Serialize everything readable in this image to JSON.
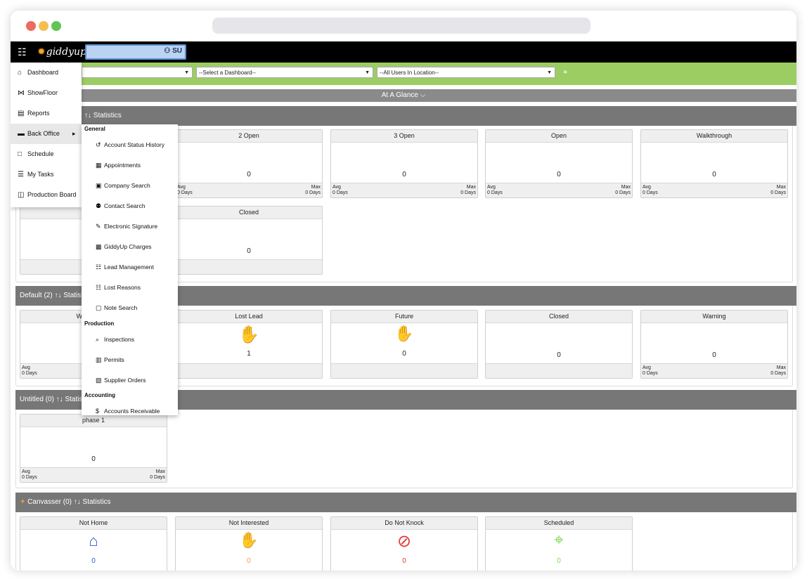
{
  "app": {
    "name": "giddyup",
    "user_badge": "SU"
  },
  "filters": {
    "select1": "",
    "select2": "--Select a Dashboard--",
    "select3": "--All Users In Location--"
  },
  "glance": "At A Glance ⌵",
  "nav": {
    "items": [
      {
        "label": "Dashboard",
        "icon": "⌂"
      },
      {
        "label": "ShowFloor",
        "icon": "⋈"
      },
      {
        "label": "Reports",
        "icon": "▤"
      },
      {
        "label": "Back Office",
        "icon": "▬",
        "caret": "▸"
      },
      {
        "label": "Schedule",
        "icon": "□"
      },
      {
        "label": "My Tasks",
        "icon": "☰"
      },
      {
        "label": "Production Board",
        "icon": "◫"
      }
    ]
  },
  "submenu": {
    "general": "General",
    "general_items": [
      {
        "label": "Account Status History",
        "icon": "↺"
      },
      {
        "label": "Appointments",
        "icon": "▦"
      },
      {
        "label": "Company Search",
        "icon": "▣"
      },
      {
        "label": "Contact Search",
        "icon": "⚉"
      },
      {
        "label": "Electronic Signature",
        "icon": "✎"
      },
      {
        "label": "GiddyUp Charges",
        "icon": "▩"
      },
      {
        "label": "Lead Management",
        "icon": "☷"
      },
      {
        "label": "Lost Reasons",
        "icon": "☷"
      },
      {
        "label": "Note Search",
        "icon": "▢"
      }
    ],
    "production": "Production",
    "production_items": [
      {
        "label": "Inspections",
        "icon": "⌕"
      },
      {
        "label": "Permits",
        "icon": "▥"
      },
      {
        "label": "Supplier Orders",
        "icon": "▧"
      }
    ],
    "accounting": "Accounting",
    "accounting_items": [
      {
        "label": "Accounts Receivable",
        "icon": "$"
      }
    ]
  },
  "sections": {
    "s1": {
      "title": "↑↓ Statistics",
      "cards": [
        {
          "title": "2 Open",
          "value": "0",
          "avg": "Avg",
          "avg_days": "0 Days",
          "max": "Max",
          "max_days": "0 Days"
        },
        {
          "title": "3 Open",
          "value": "0",
          "avg": "Avg",
          "avg_days": "0 Days",
          "max": "Max",
          "max_days": "0 Days"
        },
        {
          "title": "Open",
          "value": "0",
          "avg": "Avg",
          "avg_days": "0 Days",
          "max": "Max",
          "max_days": "0 Days"
        },
        {
          "title": "Walkthrough",
          "value": "0",
          "avg": "Avg",
          "avg_days": "0 Days",
          "max": "Max",
          "max_days": "0 Days"
        },
        {
          "title": "Closed",
          "value": "0"
        }
      ]
    },
    "s2": {
      "title": "Default (2)   ↑↓ Statist",
      "cards": [
        {
          "title": "W",
          "avg": "Avg",
          "avg_days": "0 Days"
        },
        {
          "title": "Lost Lead",
          "value": "1"
        },
        {
          "title": "Future",
          "value": "0"
        },
        {
          "title": "Closed",
          "value": "0"
        },
        {
          "title": "Warning",
          "value": "0",
          "avg": "Avg",
          "avg_days": "0 Days",
          "max": "Max",
          "max_days": "0 Days"
        }
      ]
    },
    "s3": {
      "title": "Untitled (0)   ↑↓ Statis",
      "cards": [
        {
          "title": "phase 1",
          "value": "0",
          "avg": "Avg",
          "avg_days": "0 Days",
          "max": "Max",
          "max_days": "0 Days"
        }
      ]
    },
    "s4": {
      "title": "Canvasser (0)   ↑↓ Statistics",
      "cards": [
        {
          "title": "Not Home",
          "value": "0",
          "color": "#2b57d8"
        },
        {
          "title": "Not Interested",
          "value": "0",
          "color": "#f0a030"
        },
        {
          "title": "Do Not Knock",
          "value": "0",
          "color": "#e53935"
        },
        {
          "title": "Scheduled",
          "value": "0",
          "color": "#7ed957"
        }
      ]
    }
  }
}
